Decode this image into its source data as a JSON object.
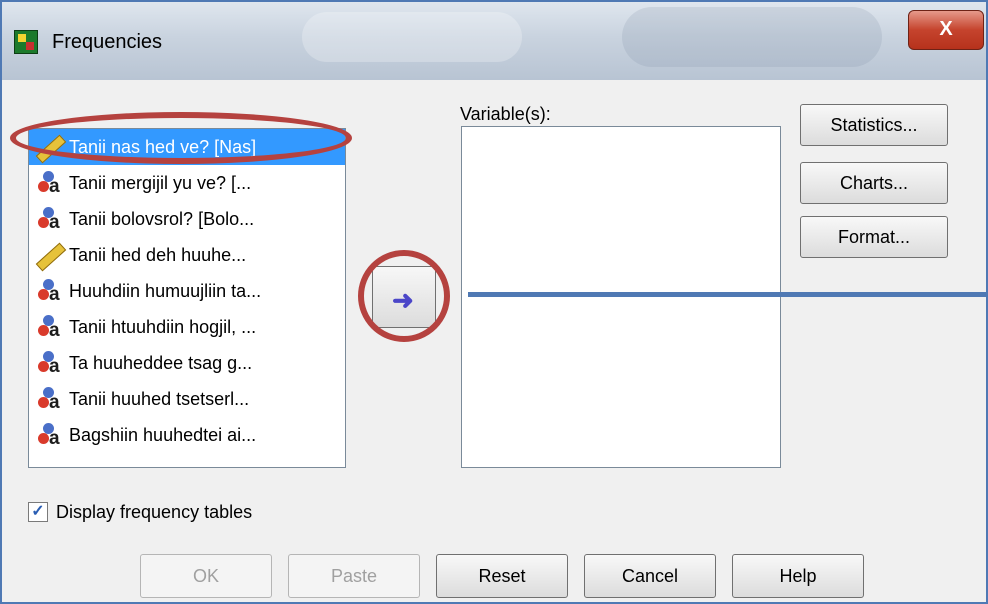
{
  "window": {
    "title": "Frequencies",
    "close_label": "X"
  },
  "source_list": {
    "items": [
      {
        "label": "Tanii nas hed ve? [Nas]",
        "icon": "scale-ruler-icon",
        "selected": true
      },
      {
        "label": "Tanii mergijil yu ve? [...",
        "icon": "nominal-icon"
      },
      {
        "label": "Tanii bolovsrol? [Bolo...",
        "icon": "nominal-icon"
      },
      {
        "label": "Tanii hed deh huuhe...",
        "icon": "scale-ruler-icon"
      },
      {
        "label": "Huuhdiin humuujliin ta...",
        "icon": "nominal-icon"
      },
      {
        "label": "Tanii htuuhdiin hogjil, ...",
        "icon": "nominal-icon"
      },
      {
        "label": "Ta huuheddee tsag g...",
        "icon": "nominal-icon"
      },
      {
        "label": "Tanii huuhed tsetserl...",
        "icon": "nominal-icon"
      },
      {
        "label": "Bagshiin huuhedtei ai...",
        "icon": "nominal-icon"
      }
    ]
  },
  "target": {
    "label": "Variable(s):"
  },
  "side_buttons": {
    "statistics": "Statistics...",
    "charts": "Charts...",
    "format": "Format..."
  },
  "checkbox": {
    "label": "Display frequency tables",
    "checked": true
  },
  "bottom_buttons": {
    "ok": "OK",
    "paste": "Paste",
    "reset": "Reset",
    "cancel": "Cancel",
    "help": "Help"
  },
  "colors": {
    "annotation": "#b5423f",
    "selection": "#3399ff",
    "frame": "#4f79b4"
  }
}
